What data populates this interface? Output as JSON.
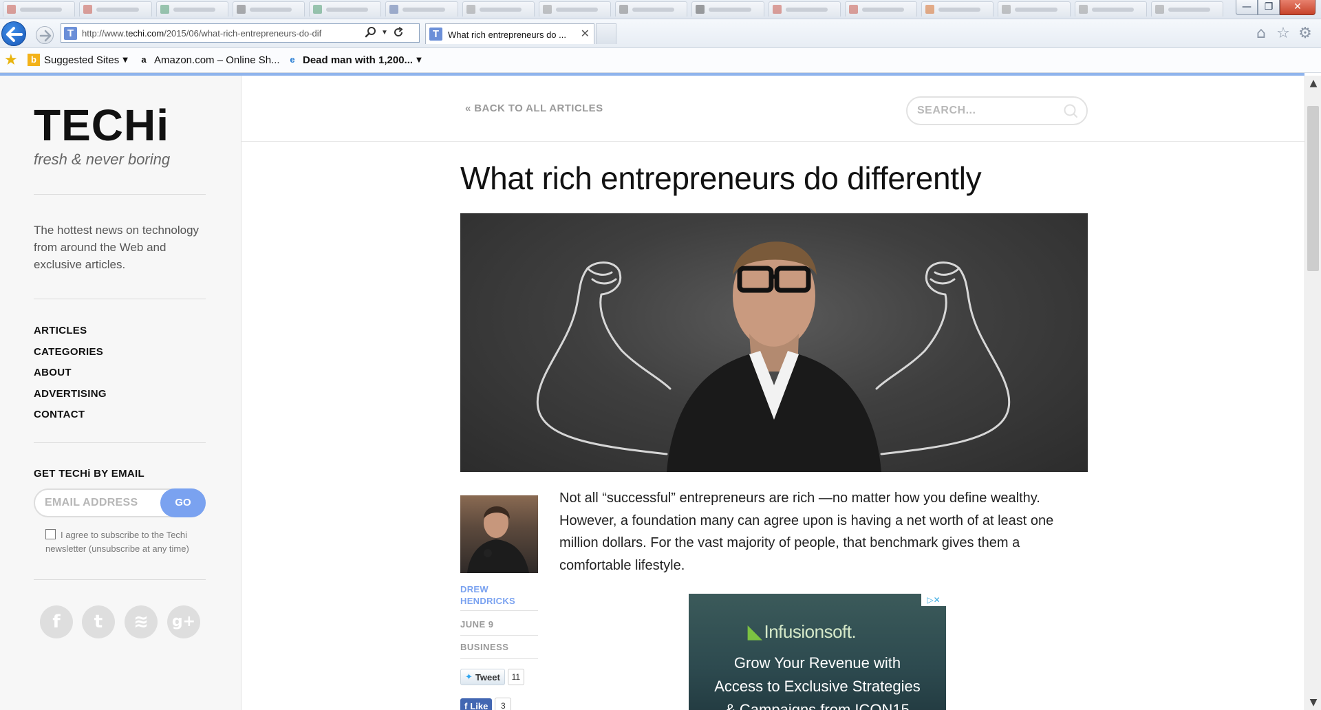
{
  "browser": {
    "url_prefix": "http://www.",
    "url_domain": "techi.com",
    "url_path": "/2015/06/what-rich-entrepreneurs-do-dif",
    "tab_title": "What rich entrepreneurs do ...",
    "tab_favicon": "T",
    "tab_close": "✕",
    "window_controls": {
      "minimize": "—",
      "restore": "❐",
      "close": "✕"
    },
    "background_tabs": 16,
    "favorites": [
      {
        "label": "Suggested Sites",
        "icon": "bing-icon",
        "has_dropdown": true
      },
      {
        "label": "Amazon.com – Online Sh...",
        "icon": "amazon-icon",
        "has_dropdown": false
      },
      {
        "label": "Dead man with 1,200...",
        "icon": "ie-page-icon",
        "has_dropdown": true
      }
    ],
    "toolbar_icons": [
      "home-icon",
      "favorites-star-icon",
      "settings-gear-icon"
    ]
  },
  "sidebar": {
    "logo": "TECHi",
    "tagline": "fresh & never boring",
    "description": "The hottest news on technology from around the Web and exclusive articles.",
    "nav": [
      "ARTICLES",
      "CATEGORIES",
      "ABOUT",
      "ADVERTISING",
      "CONTACT"
    ],
    "email_title": "GET TECHi BY EMAIL",
    "email_placeholder": "EMAIL ADDRESS",
    "go_label": "GO",
    "agree_text": "I agree to subscribe to the Techi newsletter (unsubscribe at any time)",
    "social": [
      {
        "name": "facebook",
        "glyph": "f"
      },
      {
        "name": "twitter",
        "glyph": "t"
      },
      {
        "name": "rss",
        "glyph": "≋"
      },
      {
        "name": "google-plus",
        "glyph": "g+"
      }
    ]
  },
  "topbar": {
    "back_link": "« BACK TO ALL ARTICLES",
    "search_placeholder": "SEARCH..."
  },
  "article": {
    "title": "What rich entrepreneurs do differently",
    "author": "DREW HENDRICKS",
    "date": "JUNE 9",
    "category": "BUSINESS",
    "tweet_label": "Tweet",
    "tweet_count": "11",
    "like_label": "Like",
    "like_count": "3",
    "body": "Not all “successful” entrepreneurs are rich —no matter how you define wealthy. However, a foundation many can agree upon is having a net worth of at least one million dollars. For the vast majority of people, that benchmark gives them a comfortable lifestyle."
  },
  "ad": {
    "brand": "Infusionsoft.",
    "line1": "Grow Your Revenue with",
    "line2": "Access to Exclusive Strategies",
    "line3": "& Campaigns from ICON15",
    "adchoices": "▷✕"
  }
}
